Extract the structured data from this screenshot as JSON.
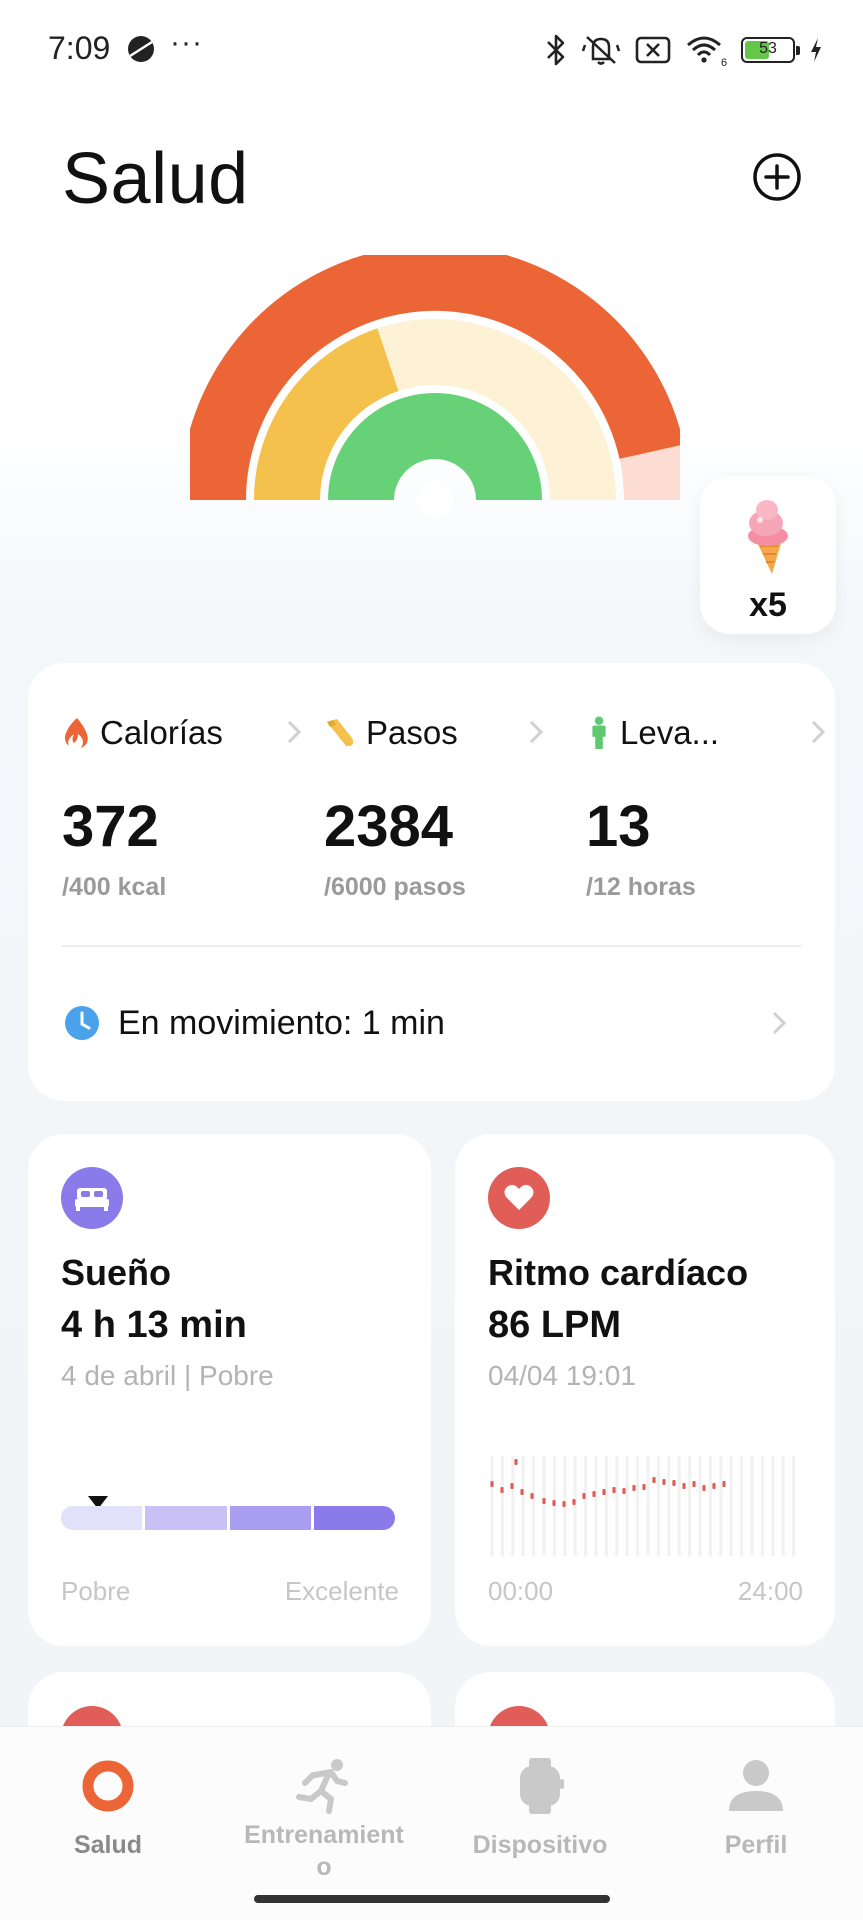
{
  "status_bar": {
    "time": "7:09",
    "more": "···",
    "battery_level": "53",
    "battery_fraction": 0.53
  },
  "header": {
    "title": "Salud",
    "add_icon": "plus-circle-icon"
  },
  "gauge": {
    "colors": {
      "calories": "#ec6536",
      "calories_track": "#fcdcd3",
      "steps": "#f4c14d",
      "steps_track": "#fdf1d6",
      "stand": "#67d178",
      "stand_track": "#dff5e2"
    },
    "calories_fraction": 0.93,
    "steps_fraction": 0.397,
    "stand_fraction": 1.0
  },
  "reward": {
    "icon": "ice-cream-icon",
    "count": "x5"
  },
  "activity": {
    "metrics": [
      {
        "icon": "flame-icon",
        "label": "Calorías",
        "value": "372",
        "goal": "/400 kcal",
        "color": "#ec6536"
      },
      {
        "icon": "shoe-icon",
        "label": "Pasos",
        "value": "2384",
        "goal": "/6000 pasos",
        "color": "#f4c14d"
      },
      {
        "icon": "person-standing-icon",
        "label": "Leva...",
        "value": "13",
        "goal": "/12 horas",
        "color": "#5fc96f"
      }
    ],
    "movement": {
      "icon": "clock-icon",
      "text": "En movimiento: 1 min"
    }
  },
  "sleep": {
    "icon": "bed-icon",
    "title": "Sueño",
    "value": "4 h 13 min",
    "subtitle": "4 de abril | Pobre",
    "scale_low": "Pobre",
    "scale_high": "Excelente",
    "score_fraction": 0.11,
    "colors": [
      "#e3e0fb",
      "#c9c1f6",
      "#a99ef1",
      "#8a7aea"
    ]
  },
  "heart_rate": {
    "icon": "heart-icon",
    "title": "Ritmo cardíaco",
    "value": "86 LPM",
    "subtitle": "04/04 19:01",
    "axis_start": "00:00",
    "axis_end": "24:00",
    "color": "#e05e57"
  },
  "nav": {
    "items": [
      {
        "label": "Salud",
        "icon": "health-ring-icon",
        "active": true
      },
      {
        "label": "Entrenamient o",
        "icon": "running-icon",
        "active": false
      },
      {
        "label": "Dispositivo",
        "icon": "watch-icon",
        "active": false
      },
      {
        "label": "Perfil",
        "icon": "profile-icon",
        "active": false
      }
    ]
  }
}
